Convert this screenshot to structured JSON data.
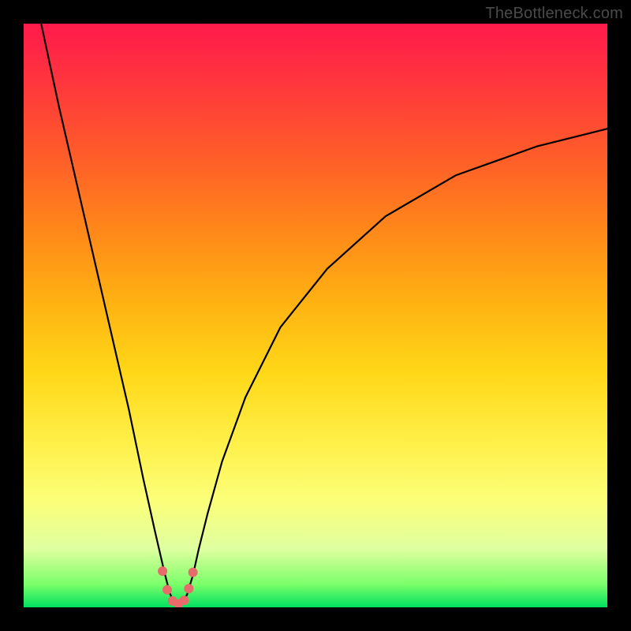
{
  "watermark": "TheBottleneck.com",
  "chart_data": {
    "type": "line",
    "title": "",
    "xlabel": "",
    "ylabel": "",
    "xlim": [
      0,
      100
    ],
    "ylim": [
      0,
      100
    ],
    "series": [
      {
        "name": "bottleneck-curve",
        "x": [
          3,
          6,
          9,
          12,
          15,
          18,
          20.5,
          22.5,
          24,
          25,
          25.8,
          26.5,
          27.2,
          28,
          29,
          30,
          31.5,
          34,
          38,
          44,
          52,
          62,
          74,
          88,
          100
        ],
        "y": [
          100,
          86,
          73,
          60,
          47,
          34,
          22,
          13,
          6.5,
          2.5,
          0.7,
          0.2,
          0.7,
          2.2,
          5.5,
          10,
          16,
          25,
          36,
          48,
          58,
          67,
          74,
          79,
          82
        ]
      }
    ],
    "markers": {
      "name": "highlight-dots",
      "x": [
        23.8,
        24.6,
        25.5,
        26.5,
        27.5,
        28.3,
        29.0
      ],
      "y": [
        6.2,
        3.0,
        1.1,
        0.6,
        1.2,
        3.2,
        6.0
      ]
    }
  }
}
